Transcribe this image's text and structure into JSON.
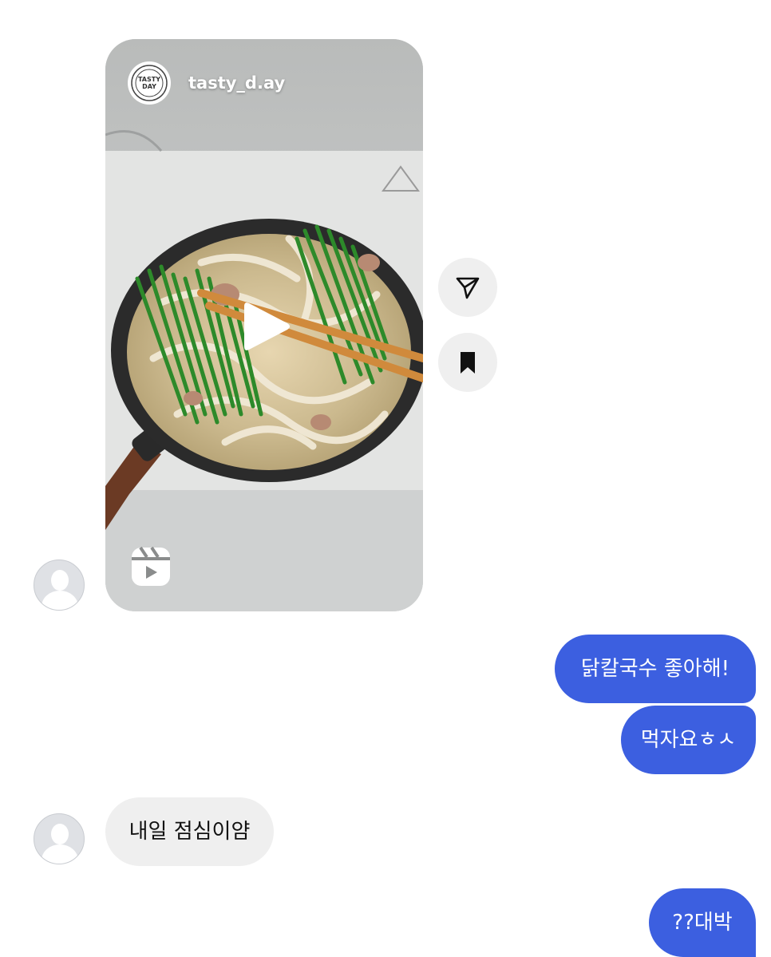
{
  "shared_reel": {
    "username": "tasty_d.ay",
    "logo_text_top": "TASTY",
    "logo_text_bottom": "DAY"
  },
  "actions": {
    "share_icon": "paper-plane-icon",
    "save_icon": "bookmark-icon"
  },
  "messages": [
    {
      "sender": "me",
      "text": "닭칼국수 좋아해!"
    },
    {
      "sender": "me",
      "text": "먹자요ㅎㅅ"
    },
    {
      "sender": "them",
      "text": "내일 점심이얌"
    },
    {
      "sender": "me",
      "text": "??대박"
    }
  ],
  "colors": {
    "outgoing_bubble": "#3c5fe0",
    "incoming_bubble": "#efefef"
  }
}
